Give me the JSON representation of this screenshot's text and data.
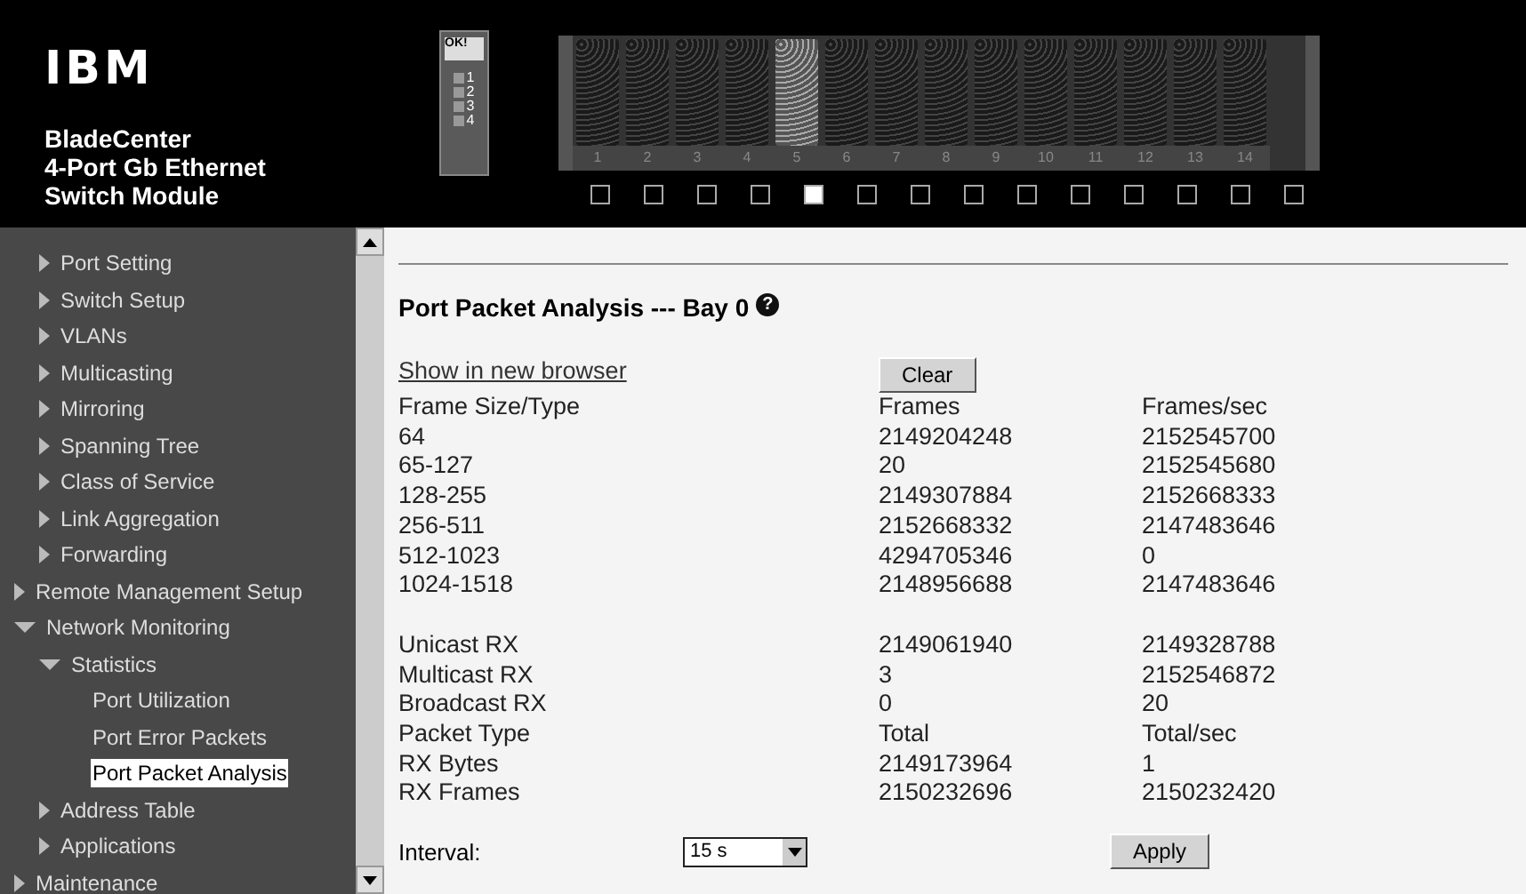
{
  "header": {
    "logo": "IBM",
    "title_lines": [
      "BladeCenter",
      "4-Port Gb Ethernet",
      "Switch Module"
    ],
    "module": {
      "status": "OK!",
      "ports": [
        "1",
        "2",
        "3",
        "4"
      ]
    },
    "bays": [
      {
        "label": "1",
        "selected": false
      },
      {
        "label": "2",
        "selected": false
      },
      {
        "label": "3",
        "selected": false
      },
      {
        "label": "4",
        "selected": false
      },
      {
        "label": "5",
        "selected": true
      },
      {
        "label": "6",
        "selected": false
      },
      {
        "label": "7",
        "selected": false
      },
      {
        "label": "8",
        "selected": false
      },
      {
        "label": "9",
        "selected": false
      },
      {
        "label": "10",
        "selected": false
      },
      {
        "label": "11",
        "selected": false
      },
      {
        "label": "12",
        "selected": false
      },
      {
        "label": "13",
        "selected": false
      },
      {
        "label": "14",
        "selected": false
      }
    ]
  },
  "sidebar": {
    "items": [
      {
        "children": [
          {
            "label": "Port Setting",
            "expanded": false,
            "selected": false
          },
          {
            "label": "Switch Setup",
            "expanded": false,
            "selected": false
          },
          {
            "label": "VLANs",
            "expanded": false,
            "selected": false
          },
          {
            "label": "Multicasting",
            "expanded": false,
            "selected": false
          },
          {
            "label": "Mirroring",
            "expanded": false,
            "selected": false
          },
          {
            "label": "Spanning Tree",
            "expanded": false,
            "selected": false
          },
          {
            "label": "Class of Service",
            "expanded": false,
            "selected": false
          },
          {
            "label": "Link Aggregation",
            "expanded": false,
            "selected": false
          },
          {
            "label": "Forwarding",
            "expanded": false,
            "selected": false
          }
        ]
      },
      {
        "label": "Remote Management Setup",
        "expanded": false,
        "selected": false
      },
      {
        "label": "Network Monitoring",
        "expanded": true,
        "selected": false,
        "children": [
          {
            "label": "Statistics",
            "expanded": true,
            "selected": false,
            "children": [
              {
                "label": "Port Utilization",
                "selected": false
              },
              {
                "label": "Port Error Packets",
                "selected": false
              },
              {
                "label": "Port Packet Analysis",
                "selected": true
              }
            ]
          },
          {
            "label": "Address Table",
            "expanded": false,
            "selected": false
          },
          {
            "label": "Applications",
            "expanded": false,
            "selected": false
          }
        ]
      },
      {
        "label": "Maintenance",
        "expanded": false,
        "selected": false
      }
    ]
  },
  "main": {
    "title": "Port Packet Analysis --- Bay 0",
    "help": "?",
    "link": "Show in new browser",
    "clear_button": "Clear",
    "table": {
      "rows": [
        [
          "Frame Size/Type",
          "Frames",
          "Frames/sec"
        ],
        [
          "64",
          "2149204248",
          "2152545700"
        ],
        [
          "65-127",
          "20",
          "2152545680"
        ],
        [
          "128-255",
          "2149307884",
          "2152668333"
        ],
        [
          "256-511",
          "2152668332",
          "2147483646"
        ],
        [
          "512-1023",
          "4294705346",
          "0"
        ],
        [
          "1024-1518",
          "2148956688",
          "2147483646"
        ],
        [],
        [
          "Unicast RX",
          "2149061940",
          "2149328788"
        ],
        [
          "Multicast RX",
          "3",
          "2152546872"
        ],
        [
          "Broadcast RX",
          "0",
          "20"
        ],
        [
          "Packet Type",
          "Total",
          "Total/sec"
        ],
        [
          "RX Bytes",
          "2149173964",
          "1"
        ],
        [
          "RX Frames",
          "2150232696",
          "2150232420"
        ]
      ]
    },
    "interval": {
      "label": "Interval:",
      "value": "15 s"
    },
    "apply_button": "Apply"
  }
}
